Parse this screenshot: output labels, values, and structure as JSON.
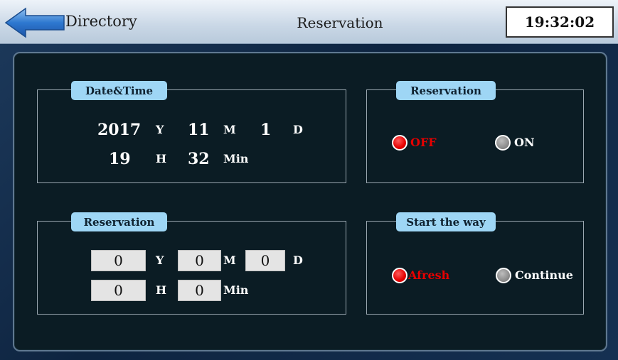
{
  "header": {
    "back_label": "Directory",
    "title": "Reservation",
    "clock": "19:32:02"
  },
  "datetime": {
    "title": "Date&Time",
    "year": "2017",
    "year_unit": "Y",
    "month": "11",
    "month_unit": "M",
    "day": "1",
    "day_unit": "D",
    "hour": "19",
    "hour_unit": "H",
    "minute": "32",
    "minute_unit": "Min"
  },
  "reservation_toggle": {
    "title": "Reservation",
    "off_label": "OFF",
    "on_label": "ON",
    "selected": "OFF"
  },
  "reservation_time": {
    "title": "Reservation",
    "year": "0",
    "year_unit": "Y",
    "month": "0",
    "month_unit": "M",
    "day": "0",
    "day_unit": "D",
    "hour": "0",
    "hour_unit": "H",
    "minute": "0",
    "minute_unit": "Min"
  },
  "start_way": {
    "title": "Start the way",
    "afresh_label": "Afresh",
    "continue_label": "Continue",
    "selected": "Afresh"
  },
  "colors": {
    "active": "#e60000",
    "inactive": "#8a8a8a",
    "group_title_bg": "#9ed6f5",
    "panel_bg": "#0b1c24"
  },
  "icons": {
    "back": "left-arrow-icon"
  }
}
